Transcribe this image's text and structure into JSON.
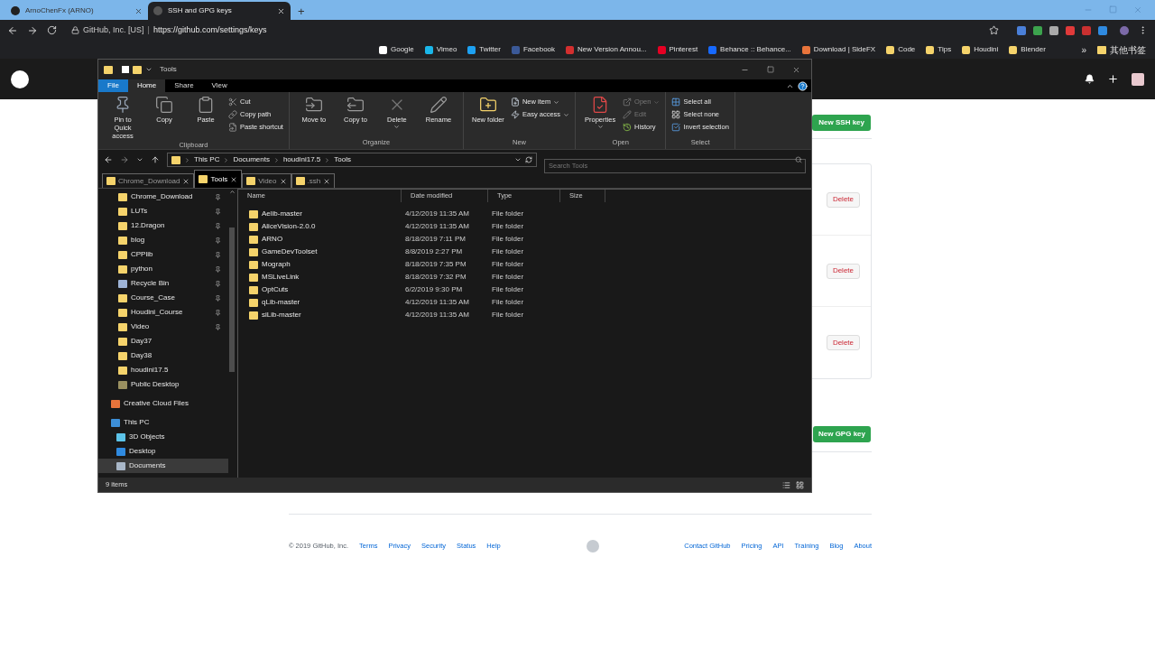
{
  "browser": {
    "tabs": [
      {
        "title": "ArnoChenFx (ARNO)",
        "selected": false
      },
      {
        "title": "SSH and GPG keys",
        "selected": true
      }
    ],
    "new_tab": "+",
    "address": {
      "site": "GitHub, Inc. [US]",
      "separator": "|",
      "url": "https://github.com/settings/keys"
    },
    "bookmarks": [
      "Google",
      "Vimeo",
      "Twitter",
      "Facebook",
      "New Version Annou...",
      "Pinterest",
      "Behance :: Behance...",
      "Download | SideFX",
      "Code",
      "Tips",
      "Houdini",
      "Blender"
    ],
    "more": "»",
    "other_bookmarks": "其他书签"
  },
  "explorer": {
    "title": "Tools",
    "ribbon_tabs": [
      {
        "label": "File",
        "kind": "file",
        "selected": false
      },
      {
        "label": "Home",
        "kind": "tab",
        "selected": true
      },
      {
        "label": "Share",
        "kind": "tab",
        "selected": false
      },
      {
        "label": "View",
        "kind": "tab",
        "selected": false
      }
    ],
    "groups": [
      {
        "name": "Clipboard",
        "items": [
          {
            "label": "Pin to Quick access",
            "kind": "large",
            "disabled": false
          },
          {
            "label": "Copy",
            "kind": "large",
            "disabled": false
          },
          {
            "label": "Paste",
            "kind": "large",
            "disabled": false
          },
          {
            "label": "Cut",
            "kind": "small",
            "disabled": false
          },
          {
            "label": "Copy path",
            "kind": "small",
            "disabled": false
          },
          {
            "label": "Paste shortcut",
            "kind": "small",
            "disabled": false
          }
        ]
      },
      {
        "name": "Organize",
        "items": [
          {
            "label": "Move to",
            "kind": "large",
            "disabled": false
          },
          {
            "label": "Copy to",
            "kind": "large",
            "disabled": false
          },
          {
            "label": "Delete",
            "kind": "large",
            "disabled": false
          },
          {
            "label": "Rename",
            "kind": "large",
            "disabled": false
          }
        ]
      },
      {
        "name": "New",
        "items": [
          {
            "label": "New folder",
            "kind": "large",
            "disabled": false
          },
          {
            "label": "New item",
            "kind": "small",
            "disabled": false
          },
          {
            "label": "Easy access",
            "kind": "small",
            "disabled": false
          }
        ]
      },
      {
        "name": "Open",
        "items": [
          {
            "label": "Properties",
            "kind": "large",
            "disabled": false
          },
          {
            "label": "Open",
            "kind": "small",
            "disabled": true
          },
          {
            "label": "Edit",
            "kind": "small",
            "disabled": true
          },
          {
            "label": "History",
            "kind": "small",
            "disabled": false
          }
        ]
      },
      {
        "name": "Select",
        "items": [
          {
            "label": "Select all",
            "kind": "small",
            "disabled": false
          },
          {
            "label": "Select none",
            "kind": "small",
            "disabled": false
          },
          {
            "label": "Invert selection",
            "kind": "small",
            "disabled": false
          }
        ]
      }
    ],
    "path": [
      "This PC",
      "Documents",
      "houdini17.5",
      "Tools"
    ],
    "search": {
      "placeholder": "Search Tools"
    },
    "folder_tabs": [
      {
        "label": "Chrome_Download",
        "selected": false
      },
      {
        "label": "Tools",
        "selected": true
      },
      {
        "label": "Video",
        "selected": false
      },
      {
        "label": ".ssh",
        "selected": false
      }
    ],
    "sidebar": [
      {
        "label": "Chrome_Download",
        "pinned": true,
        "selected": false
      },
      {
        "label": "LUTs",
        "pinned": true,
        "selected": false
      },
      {
        "label": "12.Dragon",
        "pinned": true,
        "selected": false
      },
      {
        "label": "blog",
        "pinned": true,
        "selected": false
      },
      {
        "label": "CPPlib",
        "pinned": true,
        "selected": false
      },
      {
        "label": "python",
        "pinned": true,
        "selected": false
      },
      {
        "label": "Recycle Bin",
        "pinned": true,
        "selected": false
      },
      {
        "label": "Course_Case",
        "pinned": true,
        "selected": false
      },
      {
        "label": "Houdini_Course",
        "pinned": true,
        "selected": false
      },
      {
        "label": "Video",
        "pinned": true,
        "selected": false
      },
      {
        "label": "Day37",
        "pinned": false,
        "selected": false
      },
      {
        "label": "Day38",
        "pinned": false,
        "selected": false
      },
      {
        "label": "houdini17.5",
        "pinned": false,
        "selected": false
      },
      {
        "label": "Public Desktop",
        "pinned": false,
        "selected": false
      },
      {
        "label": "Creative Cloud Files",
        "pinned": false,
        "selected": false
      },
      {
        "label": "This PC",
        "pinned": false,
        "selected": false,
        "children": [
          {
            "label": "3D Objects",
            "pinned": false,
            "selected": false
          },
          {
            "label": "Desktop",
            "pinned": false,
            "selected": false
          },
          {
            "label": "Documents",
            "pinned": false,
            "selected": true
          }
        ]
      }
    ],
    "columns": [
      "Name",
      "Date modified",
      "Type",
      "Size"
    ],
    "files": [
      {
        "name": "Aelib-master",
        "date": "4/12/2019 11:35 AM",
        "type": "File folder"
      },
      {
        "name": "AliceVision-2.0.0",
        "date": "4/12/2019 11:35 AM",
        "type": "File folder"
      },
      {
        "name": "ARNO",
        "date": "8/18/2019 7:11 PM",
        "type": "File folder"
      },
      {
        "name": "GameDevToolset",
        "date": "8/8/2019 2:27 PM",
        "type": "File folder"
      },
      {
        "name": "Mograph",
        "date": "8/18/2019 7:35 PM",
        "type": "File folder"
      },
      {
        "name": "MSLiveLink",
        "date": "8/18/2019 7:32 PM",
        "type": "File folder"
      },
      {
        "name": "OptCuts",
        "date": "6/2/2019 9:30 PM",
        "type": "File folder"
      },
      {
        "name": "qLib-master",
        "date": "4/12/2019 11:35 AM",
        "type": "File folder"
      },
      {
        "name": "siLib-master",
        "date": "4/12/2019 11:35 AM",
        "type": "File folder"
      }
    ],
    "status": "9 items"
  },
  "github": {
    "new_ssh_key": "New SSH key",
    "keys": [
      {
        "action": "Delete"
      },
      {
        "action": "Delete"
      },
      {
        "action": "Delete"
      }
    ],
    "new_gpg_key": "New GPG key",
    "footer": {
      "copyright": "© 2019 GitHub, Inc.",
      "left_links": [
        "Terms",
        "Privacy",
        "Security",
        "Status",
        "Help"
      ],
      "right_links": [
        "Contact GitHub",
        "Pricing",
        "API",
        "Training",
        "Blog",
        "About"
      ]
    }
  }
}
